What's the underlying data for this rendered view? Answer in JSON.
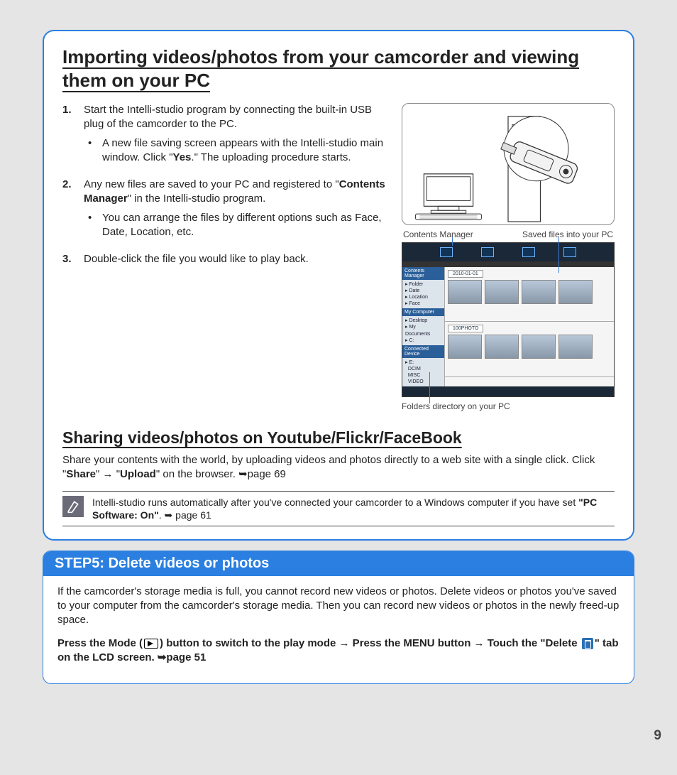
{
  "section1": {
    "title": "Importing videos/photos from your camcorder and viewing them on your PC",
    "steps": [
      {
        "num": "1.",
        "text": "Start the Intelli-studio program by connecting the built-in USB plug of the camcorder to the PC.",
        "bullets": [
          {
            "pre": "A new file saving screen appears with the Intelli-studio main window. Click \"",
            "bold": "Yes",
            "post": ".\" The uploading procedure starts."
          }
        ]
      },
      {
        "num": "2.",
        "text_pre": "Any new files are saved to your PC and registered to \"",
        "text_bold": "Contents Manager",
        "text_post": "\" in the Intelli-studio program.",
        "bullets": [
          {
            "pre": "You can arrange the files by different options such as Face, Date, Location, etc.",
            "bold": "",
            "post": ""
          }
        ]
      },
      {
        "num": "3.",
        "text": "Double-click the file you would like to play back."
      }
    ],
    "label_contents_manager": "Contents Manager",
    "label_saved_files": "Saved files into your PC",
    "label_folders": "Folders directory on your PC"
  },
  "section2": {
    "title": "Sharing videos/photos on Youtube/Flickr/FaceBook",
    "text_pre": "Share your contents with the world, by uploading videos and photos directly to a web site with a single click. Click \"",
    "b1": "Share",
    "mid1": "\" → \"",
    "b2": "Upload",
    "post": "\" on the browser. ➥page 69"
  },
  "note": {
    "pre": "Intelli-studio runs automatically after you've connected your camcorder to a Windows computer if you have set ",
    "bold": "\"PC Software: On\"",
    "post": ". ➥ page 61"
  },
  "step5": {
    "header": "STEP5: Delete videos or photos",
    "p1": "If the camcorder's storage media is full, you cannot record new videos or photos. Delete videos or photos you've saved to your computer from the camcorder's storage media. Then you can record new videos or photos in the newly freed-up space.",
    "p2_a": "Press the Mode (",
    "p2_b": ") button to switch to the play mode → Press the MENU button → Touch the \"Delete ",
    "p2_c": "\" tab on the LCD screen. ➥page 51"
  },
  "page_number": "9"
}
